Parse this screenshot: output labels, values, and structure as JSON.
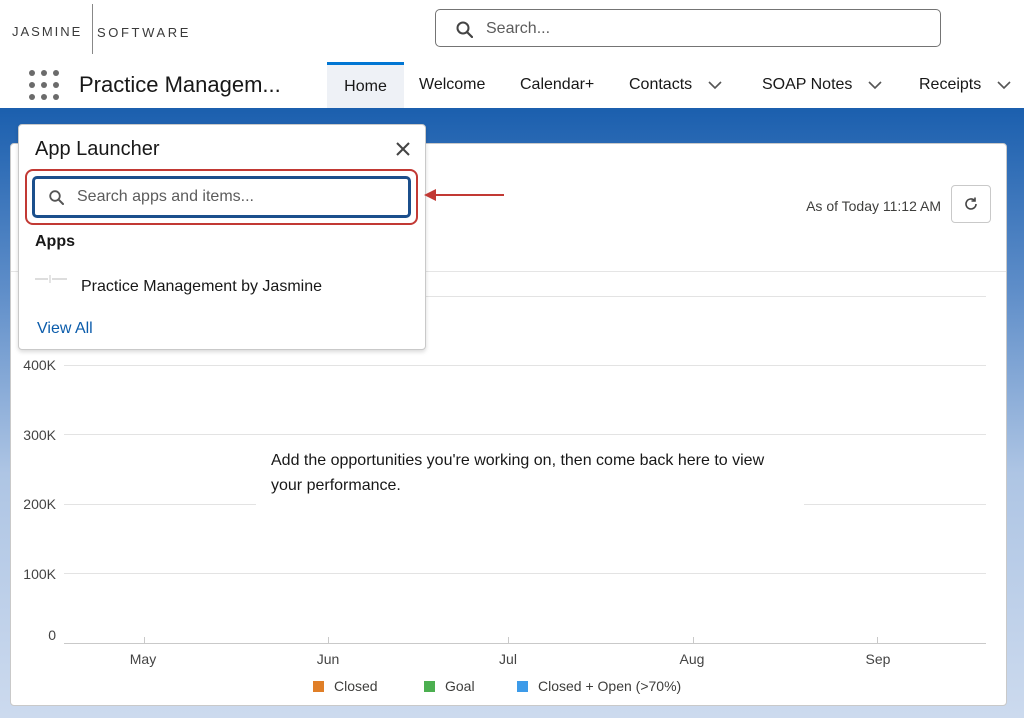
{
  "brand": {
    "left": "JASMINE",
    "right": "SOFTWARE"
  },
  "header": {
    "search_placeholder": "Search..."
  },
  "nav": {
    "app_name": "Practice Managem...",
    "tabs": [
      {
        "label": "Home",
        "active": true,
        "dropdown": false
      },
      {
        "label": "Welcome",
        "active": false,
        "dropdown": false
      },
      {
        "label": "Calendar+",
        "active": false,
        "dropdown": false
      },
      {
        "label": "Contacts",
        "active": false,
        "dropdown": true
      },
      {
        "label": "SOAP Notes",
        "active": false,
        "dropdown": true
      },
      {
        "label": "Receipts",
        "active": false,
        "dropdown": true
      }
    ]
  },
  "app_launcher": {
    "title": "App Launcher",
    "search_placeholder": "Search apps and items...",
    "apps_heading": "Apps",
    "apps": [
      {
        "label": "Practice Management by Jasmine"
      }
    ],
    "view_all": "View All"
  },
  "card": {
    "as_of": "As of Today 11:12 AM",
    "empty_message": "Add the opportunities you're working on, then come back here to view your performance."
  },
  "chart_data": {
    "type": "line",
    "x_ticks": [
      "May",
      "Jun",
      "Jul",
      "Aug",
      "Sep"
    ],
    "y_ticks": [
      "0",
      "100K",
      "200K",
      "300K",
      "400K"
    ],
    "ylim": [
      0,
      400000
    ],
    "series": [
      {
        "name": "Closed",
        "color": "#e07f28",
        "values": []
      },
      {
        "name": "Goal",
        "color": "#4caf50",
        "values": []
      },
      {
        "name": "Closed + Open (>70%)",
        "color": "#3d9be9",
        "values": []
      }
    ],
    "grid": true,
    "legend": "bottom"
  },
  "colors": {
    "accent": "#0176d3",
    "highlight": "#c23934"
  }
}
